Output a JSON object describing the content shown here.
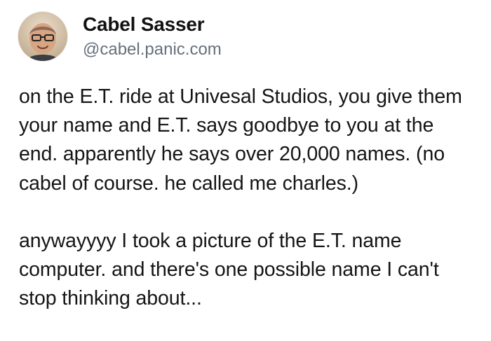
{
  "post": {
    "author": {
      "display_name": "Cabel Sasser",
      "handle": "@cabel.panic.com",
      "avatar_icon": "profile-photo"
    },
    "paragraphs": [
      "on the E.T. ride at Univesal Studios, you give them your name and E.T. says goodbye to you at the end. apparently he says over 20,000 names. (no cabel of course. he called me charles.)",
      "anywayyyy I took a picture of the E.T. name computer. and there's one possible name I can't stop thinking about..."
    ]
  },
  "colors": {
    "text": "#151515",
    "handle": "#66707a",
    "background": "#ffffff"
  }
}
